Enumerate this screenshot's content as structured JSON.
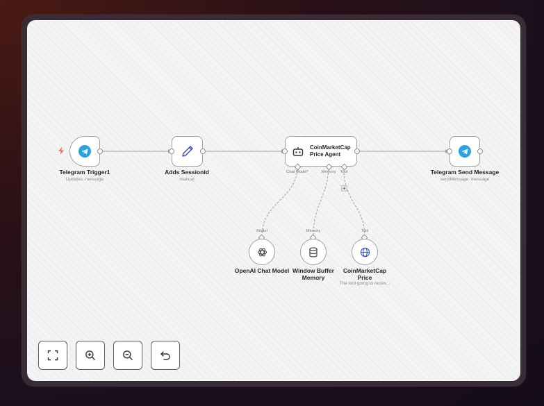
{
  "nodes": {
    "telegram_trigger": {
      "title": "Telegram Trigger1",
      "subtitle": "Updates: message",
      "icon": "telegram-icon"
    },
    "adds_session": {
      "title": "Adds SessionId",
      "subtitle": "manual",
      "icon": "pencil-icon"
    },
    "agent": {
      "title_line1": "CoinMarketCap",
      "title_line2": "Price Agent",
      "icon": "robot-icon",
      "ports": {
        "chat_model": "Chat Model",
        "chat_model_required": "*",
        "memory": "Memory",
        "tool": "Tool"
      }
    },
    "telegram_send": {
      "title": "Telegram Send Message",
      "subtitle": "sendMessage: message",
      "icon": "telegram-icon"
    },
    "openai": {
      "title": "OpenAI Chat Model",
      "port": "Model",
      "icon": "openai-icon"
    },
    "memory": {
      "title_line1": "Window Buffer",
      "title_line2": "Memory",
      "port": "Memory",
      "icon": "database-icon"
    },
    "coinmarketcap": {
      "title_line1": "CoinMarketCap",
      "title_line2": "Price",
      "subtitle": "The tool going to reciev...",
      "port": "Tool",
      "icon": "globe-icon"
    }
  },
  "add_tool_label": "+",
  "controls": [
    {
      "name": "fit-view-button",
      "icon": "fullscreen-icon"
    },
    {
      "name": "zoom-in-button",
      "icon": "zoom-in-icon"
    },
    {
      "name": "zoom-out-button",
      "icon": "zoom-out-icon"
    },
    {
      "name": "reset-zoom-button",
      "icon": "undo-icon"
    }
  ],
  "colors": {
    "telegram": "#2aa3df",
    "trigger_bolt": "#ff6d5a",
    "pencil": "#3b4cc0",
    "globe": "#2f4fd6"
  }
}
